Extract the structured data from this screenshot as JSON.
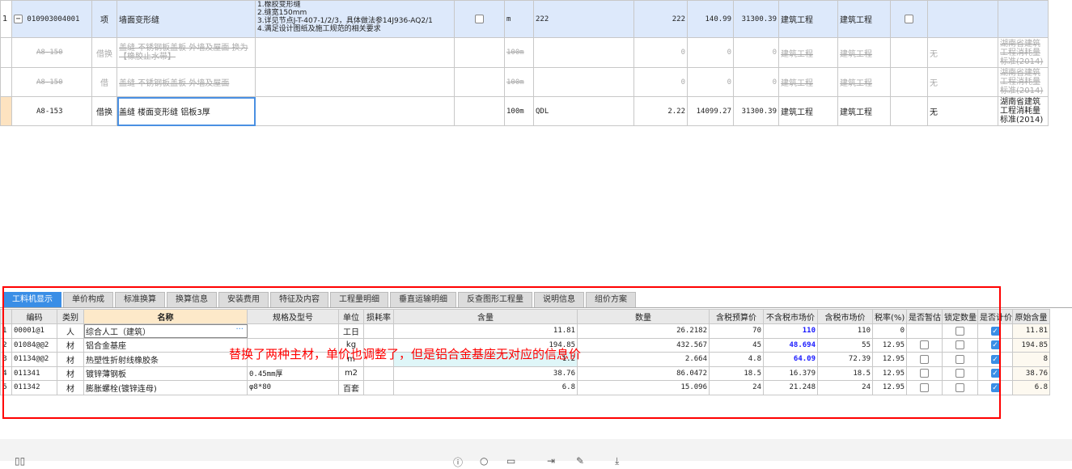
{
  "top_table": {
    "rows": [
      {
        "no": "1",
        "code": "010903004001",
        "type": "项",
        "name": "墙面变形缝",
        "features": [
          "1.橡胶变形缝",
          "2.缝宽150mm",
          "3.详见节点J-T-407-1/2/3，具体做法参14J936-AQ2/1",
          "4.满足设计图纸及施工规范的相关要求"
        ],
        "unit": "m",
        "expr": "222",
        "qty": "222",
        "price": "140.99",
        "total": "31300.39",
        "major1": "建筑工程",
        "major2": "建筑工程",
        "extra": "",
        "std": ""
      },
      {
        "no": "",
        "code": "A8-150",
        "type": "借换",
        "name": "盖缝 不锈钢板盖板 外墙及屋面  换为【橡胶止水带】",
        "features": [],
        "unit": "100m",
        "expr": "",
        "qty": "0",
        "price": "0",
        "total": "0",
        "major1": "建筑工程",
        "major2": "建筑工程",
        "extra": "无",
        "std": "湖南省建筑工程消耗量标准(2014)"
      },
      {
        "no": "",
        "code": "A8-150",
        "type": "借",
        "name": "盖缝 不锈钢板盖板 外墙及屋面",
        "features": [],
        "unit": "100m",
        "expr": "",
        "qty": "0",
        "price": "0",
        "total": "0",
        "major1": "建筑工程",
        "major2": "建筑工程",
        "extra": "无",
        "std": "湖南省建筑工程消耗量标准(2014)"
      },
      {
        "no": "",
        "code": "A8-153",
        "type": "借换",
        "name": "盖缝 楼面变形缝 铝板3厚",
        "features": [],
        "unit": "100m",
        "expr": "QDL",
        "qty": "2.22",
        "price": "14099.27",
        "total": "31300.39",
        "major1": "建筑工程",
        "major2": "建筑工程",
        "extra": "无",
        "std": "湖南省建筑工程消耗量标准(2014)"
      }
    ]
  },
  "tabs": [
    "工料机显示",
    "单价构成",
    "标准换算",
    "换算信息",
    "安装费用",
    "特征及内容",
    "工程量明细",
    "垂直运输明细",
    "反查图形工程量",
    "说明信息",
    "组价方案"
  ],
  "bottom_table": {
    "headers": [
      "",
      "编码",
      "类别",
      "名称",
      "规格及型号",
      "单位",
      "损耗率",
      "含量",
      "数量",
      "含税预算价",
      "不含税市场价",
      "含税市场价",
      "税率(%)",
      "是否暂估",
      "锁定数量",
      "是否计价",
      "原始含量"
    ],
    "rows": [
      {
        "no": "1",
        "code": "00001@1",
        "type": "人",
        "name": "综合人工（建筑）",
        "spec": "",
        "unit": "工日",
        "loss": "",
        "content": "11.81",
        "qty": "26.2182",
        "budget": "70",
        "market_notax": "110",
        "market_tax": "110",
        "tax": "0",
        "orig": "11.81"
      },
      {
        "no": "2",
        "code": "01084@@2",
        "type": "材",
        "name": "铝合金基座",
        "spec": "",
        "unit": "kg",
        "loss": "",
        "content": "194.85",
        "qty": "432.567",
        "budget": "45",
        "market_notax": "48.694",
        "market_tax": "55",
        "tax": "12.95",
        "orig": "194.85"
      },
      {
        "no": "3",
        "code": "01134@@2",
        "type": "材",
        "name": "热塑性折射线橡胶条",
        "spec": "",
        "unit": "m",
        "loss": "",
        "content": "1.2",
        "qty": "2.664",
        "budget": "4.8",
        "market_notax": "64.09",
        "market_tax": "72.39",
        "tax": "12.95",
        "orig": "8"
      },
      {
        "no": "4",
        "code": "011341",
        "type": "材",
        "name": "镀锌薄钢板",
        "spec": "0.45mm厚",
        "unit": "m2",
        "loss": "",
        "content": "38.76",
        "qty": "86.0472",
        "budget": "18.5",
        "market_notax": "16.379",
        "market_tax": "18.5",
        "tax": "12.95",
        "orig": "38.76"
      },
      {
        "no": "5",
        "code": "011342",
        "type": "材",
        "name": "膨胀螺栓(镀锌连母)",
        "spec": "φ8*80",
        "unit": "百套",
        "loss": "",
        "content": "6.8",
        "qty": "15.096",
        "budget": "24",
        "market_notax": "21.248",
        "market_tax": "24",
        "tax": "12.95",
        "orig": "6.8"
      }
    ]
  },
  "annotation": "替换了两种主材，单价也调整了，但是铝合金基座无对应的信息价",
  "ellipsis": "···",
  "colors": {
    "accent": "#3a8ee6",
    "annotation": "#ff0000",
    "row_bg": "#dde9fb"
  }
}
